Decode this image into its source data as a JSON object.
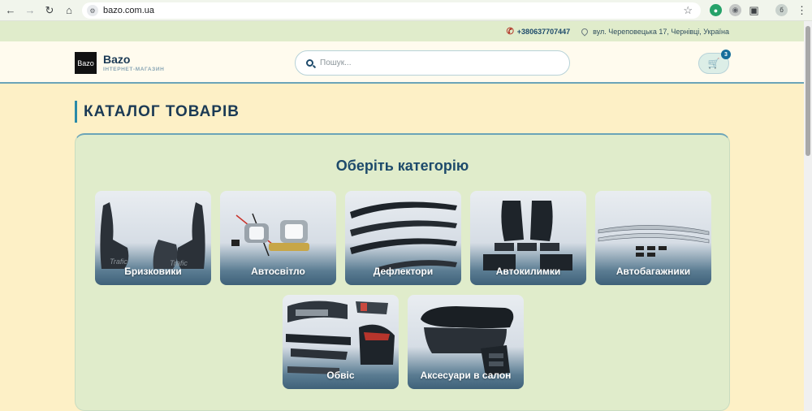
{
  "browser": {
    "url": "bazo.com.ua",
    "profile_initial": "б"
  },
  "topbar": {
    "phone": "+380637707447",
    "address": "вул. Череповецька 17, Чернівці, Україна"
  },
  "header": {
    "logo_text": "Bazo",
    "brand_name": "Bazo",
    "brand_subtitle": "ІНТЕРНЕТ-МАГАЗИН",
    "search_placeholder": "Пошук...",
    "cart_count": "3"
  },
  "page": {
    "title": "КАТАЛОГ ТОВАРІВ",
    "catalog_heading": "Оберіть категорію"
  },
  "categories": [
    {
      "label": "Бризковики",
      "icon": "mudflaps"
    },
    {
      "label": "Автосвітло",
      "icon": "headlight-bulbs"
    },
    {
      "label": "Дефлектори",
      "icon": "window-deflectors"
    },
    {
      "label": "Автокилимки",
      "icon": "car-mats"
    },
    {
      "label": "Автобагажники",
      "icon": "roof-rails"
    },
    {
      "label": "Обвіс",
      "icon": "body-kit"
    },
    {
      "label": "Аксесуари в салон",
      "icon": "armrest"
    }
  ],
  "colors": {
    "page_bg": "#fdf0c6",
    "topbar_bg": "#e0eccb",
    "accent": "#1d4a6b",
    "badge": "#176e9a"
  }
}
